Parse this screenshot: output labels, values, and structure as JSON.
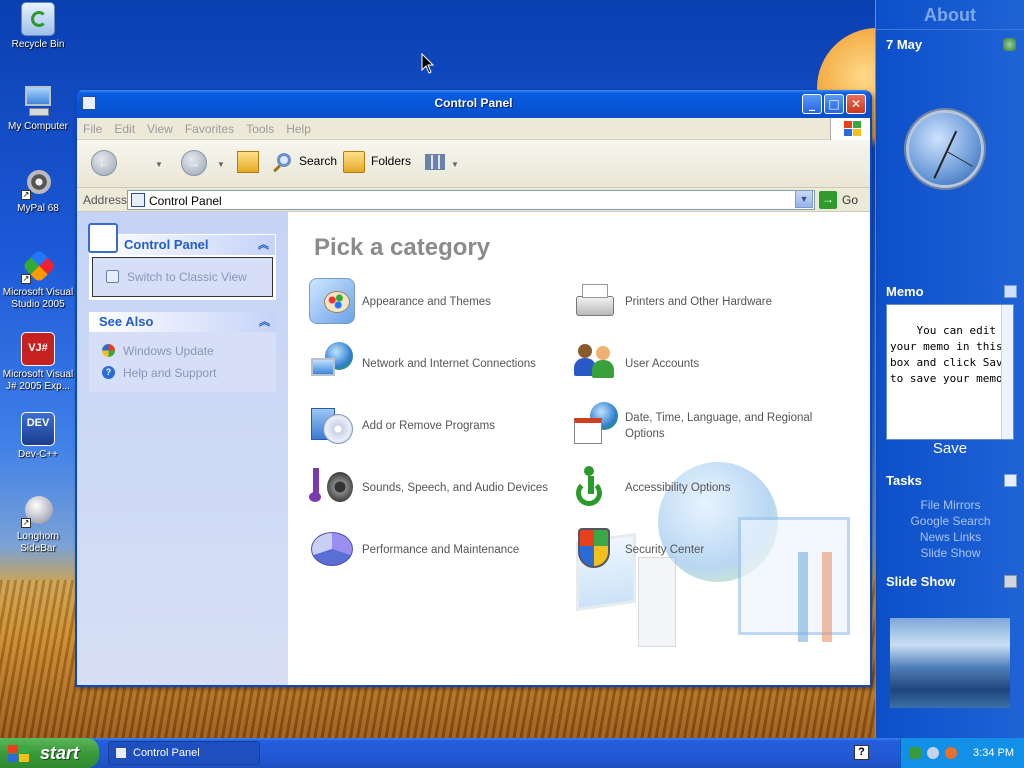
{
  "desktop": {
    "icons": [
      {
        "label": "Recycle Bin"
      },
      {
        "label": "My Computer"
      },
      {
        "label": "MyPal 68"
      },
      {
        "label": "Microsoft Visual Studio 2005"
      },
      {
        "label": "Microsoft Visual J# 2005 Exp..."
      },
      {
        "label": "Dev-C++"
      },
      {
        "label": "Longhorn SideBar"
      }
    ],
    "dev_badge": "DEV",
    "vj_badge": "VJ#"
  },
  "sidebar": {
    "about_label": "About",
    "date": "7 May",
    "memo_title": "Memo",
    "memo_text": "You can edit your memo in this box and click Save to save your memo.",
    "save_label": "Save",
    "tasks_title": "Tasks",
    "tasks": [
      "File Mirrors",
      "Google Search",
      "News Links",
      "Slide Show"
    ],
    "slideshow_title": "Slide Show"
  },
  "window": {
    "title": "Control Panel",
    "controls": {
      "minimize": "_",
      "maximize": "□",
      "close": "✕"
    },
    "menu": [
      "File",
      "Edit",
      "View",
      "Favorites",
      "Tools",
      "Help"
    ],
    "toolbar": {
      "back": "←",
      "forward": "→",
      "search_label": "Search",
      "folders_label": "Folders"
    },
    "address": {
      "label": "Address",
      "value": "Control Panel",
      "go_label": "Go"
    }
  },
  "leftpane": {
    "control_panel_title": "Control Panel",
    "switch_view": "Switch to Classic View",
    "see_also_title": "See Also",
    "see_also_links": [
      "Windows Update",
      "Help and Support"
    ]
  },
  "main": {
    "heading": "Pick a category",
    "categories": [
      {
        "label": "Appearance and Themes",
        "icon": "appearance-themes-icon"
      },
      {
        "label": "Printers and Other Hardware",
        "icon": "printers-hardware-icon"
      },
      {
        "label": "Network and Internet Connections",
        "icon": "network-internet-icon"
      },
      {
        "label": "User Accounts",
        "icon": "user-accounts-icon"
      },
      {
        "label": "Add or Remove Programs",
        "icon": "add-remove-programs-icon"
      },
      {
        "label": "Date, Time, Language, and Regional Options",
        "icon": "date-time-language-icon"
      },
      {
        "label": "Sounds, Speech, and Audio Devices",
        "icon": "sounds-audio-icon"
      },
      {
        "label": "Accessibility Options",
        "icon": "accessibility-icon"
      },
      {
        "label": "Performance and Maintenance",
        "icon": "performance-maintenance-icon"
      },
      {
        "label": "Security Center",
        "icon": "security-center-icon"
      }
    ]
  },
  "taskbar": {
    "start_label": "start",
    "task_button": "Control Panel",
    "help_glyph": "?",
    "time": "3:34 PM"
  }
}
